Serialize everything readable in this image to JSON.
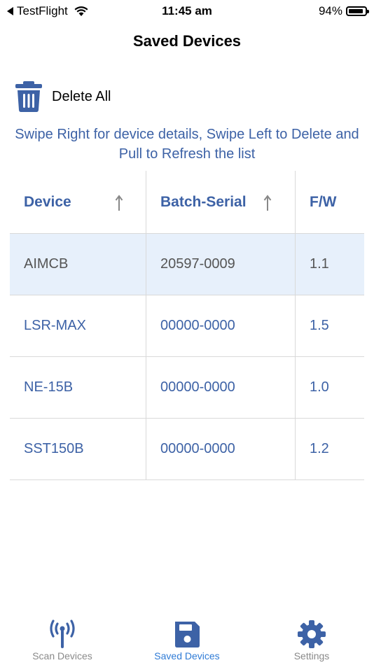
{
  "status_bar": {
    "back_app": "TestFlight",
    "time": "11:45 am",
    "battery": "94%"
  },
  "nav": {
    "title": "Saved Devices"
  },
  "toolbar": {
    "delete_all_label": "Delete All"
  },
  "hint": {
    "text": "Swipe Right for device details, Swipe Left to Delete and Pull to Refresh the list"
  },
  "table": {
    "headers": [
      "Device",
      "Batch-Serial",
      "F/W"
    ],
    "rows": [
      {
        "device": "AIMCB",
        "serial": "20597-0009",
        "fw": "1.1"
      },
      {
        "device": "LSR-MAX",
        "serial": "00000-0000",
        "fw": "1.5"
      },
      {
        "device": "NE-15B",
        "serial": "00000-0000",
        "fw": "1.0"
      },
      {
        "device": "SST150B",
        "serial": "00000-0000",
        "fw": "1.2"
      }
    ]
  },
  "tabs": [
    {
      "label": "Scan Devices",
      "icon": "antenna-icon"
    },
    {
      "label": "Saved Devices",
      "icon": "floppy-disk-icon"
    },
    {
      "label": "Settings",
      "icon": "gear-icon"
    }
  ],
  "colors": {
    "accent": "#3d62a6",
    "tab_active": "#2f7bd6",
    "selected_row": "#e7f0fb"
  }
}
